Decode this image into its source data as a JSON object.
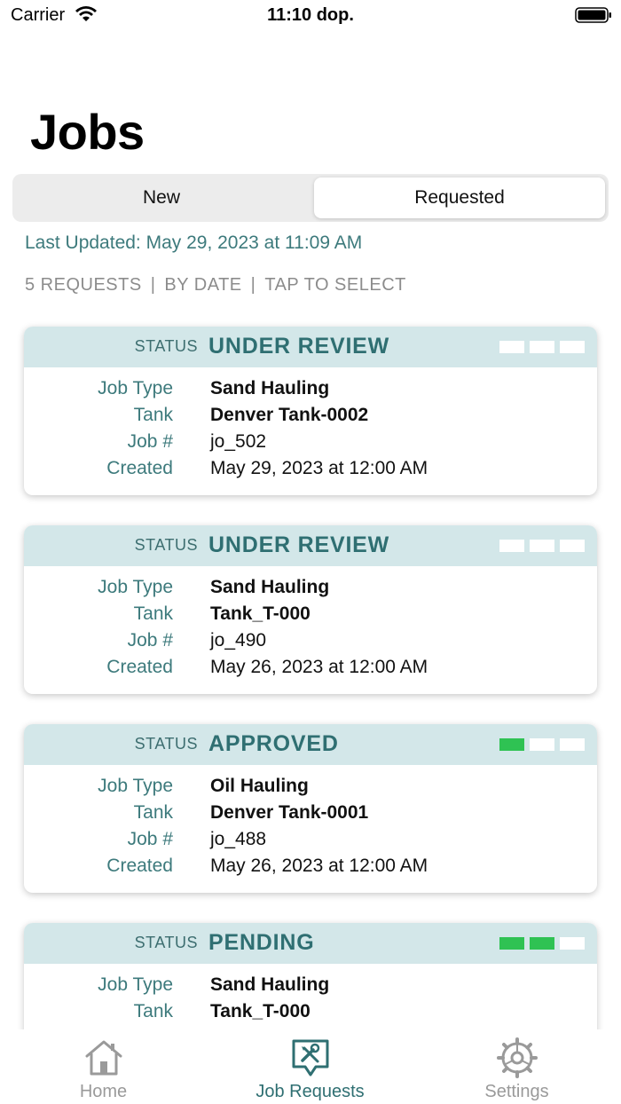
{
  "status_bar": {
    "carrier": "Carrier",
    "time": "11:10 dop."
  },
  "header": {
    "title": "Jobs"
  },
  "segments": {
    "new_label": "New",
    "requested_label": "Requested",
    "selected": "Requested"
  },
  "last_updated": "Last Updated: May 29, 2023 at 11:09 AM",
  "summary": {
    "count": "5 REQUESTS",
    "sort": "BY DATE",
    "hint": "TAP TO SELECT",
    "separator": "|"
  },
  "field_labels": {
    "status": "STATUS",
    "job_type": "Job Type",
    "tank": "Tank",
    "job_no": "Job #",
    "created": "Created"
  },
  "requests": [
    {
      "status": "UNDER REVIEW",
      "progress_steps_done": 0,
      "progress_steps_total": 3,
      "job_type": "Sand Hauling",
      "tank": "Denver Tank-0002",
      "job_no": "jo_502",
      "created": "May 29, 2023 at 12:00 AM"
    },
    {
      "status": "UNDER REVIEW",
      "progress_steps_done": 0,
      "progress_steps_total": 3,
      "job_type": "Sand Hauling",
      "tank": "Tank_T-000",
      "job_no": "jo_490",
      "created": "May 26, 2023 at 12:00 AM"
    },
    {
      "status": "APPROVED",
      "progress_steps_done": 1,
      "progress_steps_total": 3,
      "job_type": "Oil Hauling",
      "tank": "Denver Tank-0001",
      "job_no": "jo_488",
      "created": "May 26, 2023 at 12:00 AM"
    },
    {
      "status": "PENDING",
      "progress_steps_done": 2,
      "progress_steps_total": 3,
      "job_type": "Sand Hauling",
      "tank": "Tank_T-000",
      "job_no": "",
      "created": ""
    }
  ],
  "tab_bar": {
    "items": [
      {
        "label": "Home",
        "icon": "home-icon",
        "active": false
      },
      {
        "label": "Job Requests",
        "icon": "job-requests-icon",
        "active": true
      },
      {
        "label": "Settings",
        "icon": "gear-icon",
        "active": false
      }
    ]
  },
  "colors": {
    "accent": "#2f6f72",
    "status_header_bg": "#d3e7e9",
    "progress_on": "#2fc253",
    "muted": "#8c8c8c"
  }
}
